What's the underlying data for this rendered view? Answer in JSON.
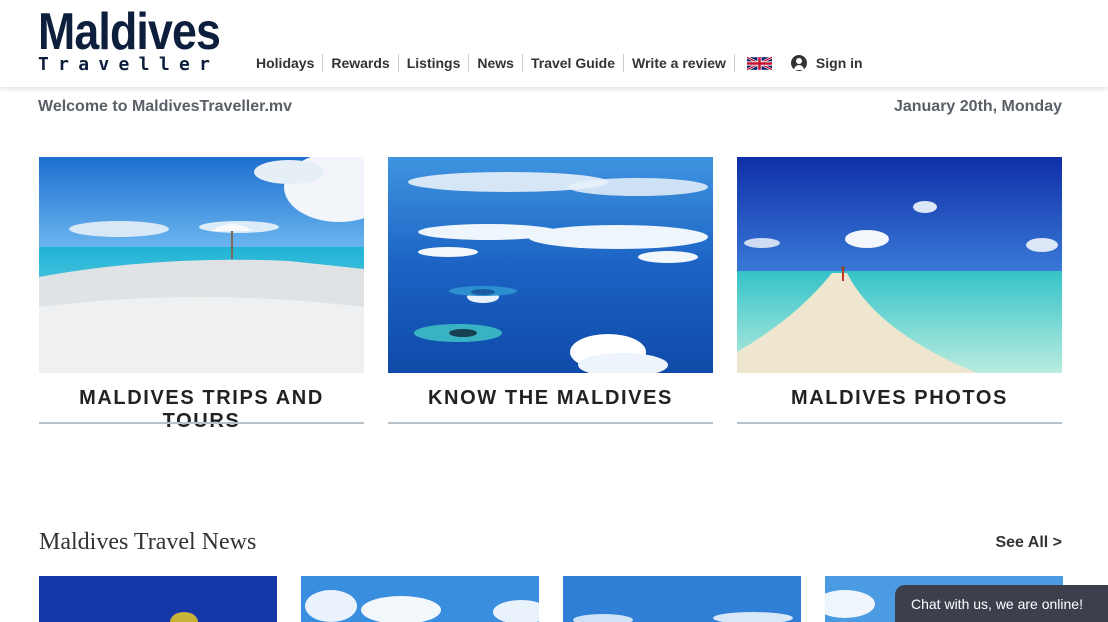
{
  "logo": {
    "main": "Maldives",
    "sub": "Traveller"
  },
  "nav": {
    "items": [
      "Holidays",
      "Rewards",
      "Listings",
      "News",
      "Travel Guide",
      "Write a review"
    ],
    "language_icon": "uk-flag-icon",
    "signin_label": "Sign in",
    "signin_icon": "user-circle-icon"
  },
  "welcome_text": "Welcome to MaldivesTraveller.mv",
  "date_text": "January 20th, Monday",
  "cards": [
    {
      "title": "MALDIVES TRIPS AND TOURS"
    },
    {
      "title": "KNOW THE MALDIVES"
    },
    {
      "title": "MALDIVES PHOTOS"
    }
  ],
  "news": {
    "heading": "Maldives Travel News",
    "see_all": "See All >"
  },
  "chat": {
    "label": "Chat with us, we are online!"
  },
  "colors": {
    "brand": "#0d1f3c",
    "divider": "#b8c2cc",
    "chat_bg": "#3d3f4d"
  }
}
